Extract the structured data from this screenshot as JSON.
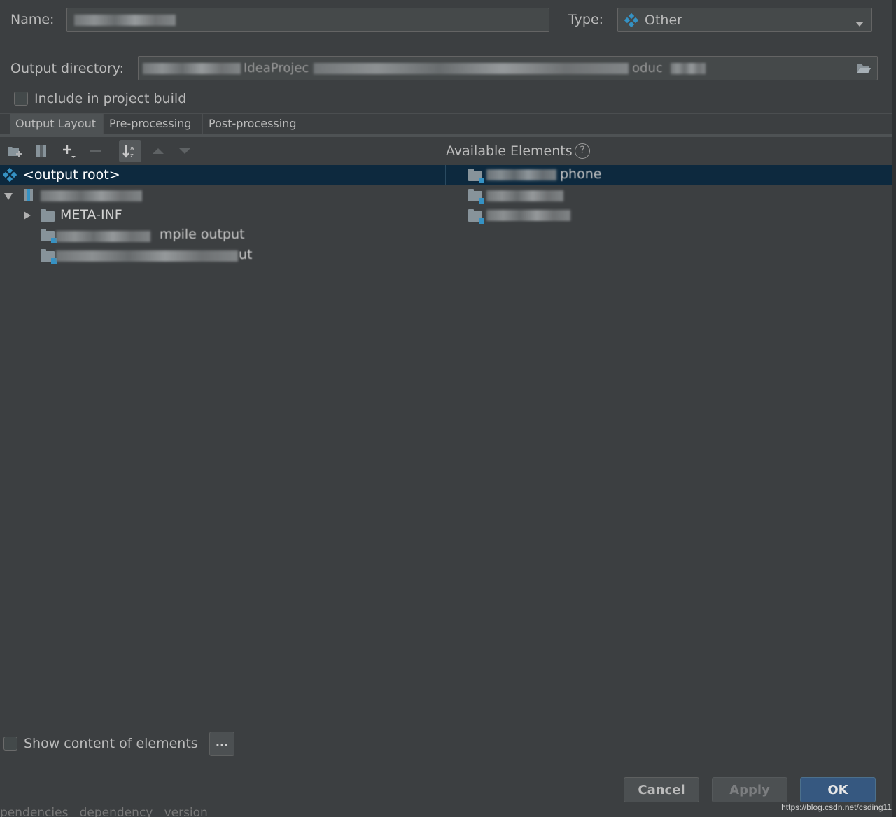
{
  "form": {
    "name_label": "Name:",
    "type_label": "Type:",
    "type_value": "Other",
    "output_dir_label": "Output directory:",
    "output_dir_visible_fragments": [
      "IdeaProjec",
      "oduc"
    ],
    "include_build_label": "Include in project build",
    "include_build_checked": false
  },
  "tabs": [
    {
      "label": "Output Layout",
      "active": true
    },
    {
      "label": "Pre-processing",
      "active": false
    },
    {
      "label": "Post-processing",
      "active": false
    }
  ],
  "available": {
    "heading": "Available Elements",
    "help": "?",
    "items": [
      {
        "suffix": "phone"
      },
      {
        "suffix": ""
      },
      {
        "suffix": ""
      }
    ]
  },
  "tree": {
    "root": "<output root>",
    "meta_inf": "META-INF",
    "compile_output_fragment": "mpile output",
    "last_fragment": "ut"
  },
  "footer": {
    "show_content_label": "Show content of elements",
    "ellipsis": "...",
    "cancel": "Cancel",
    "apply": "Apply",
    "ok": "OK",
    "watermark": "https://blog.csdn.net/csding11",
    "bg_fragments": "pendencies   dependency   version"
  },
  "colors": {
    "background": "#3c3f41",
    "selection": "#0d293e",
    "accent": "#3592c4",
    "ok_button": "#365880"
  },
  "icons": {
    "type": "artifact-diamond-icon",
    "dropdown": "chevron-down-icon",
    "browse": "folder-open-icon",
    "new_dir": "new-folder-icon",
    "archive": "archive-icon",
    "add": "plus-icon",
    "remove": "minus-icon",
    "sort": "sort-az-icon",
    "up": "move-up-icon",
    "down": "move-down-icon"
  }
}
